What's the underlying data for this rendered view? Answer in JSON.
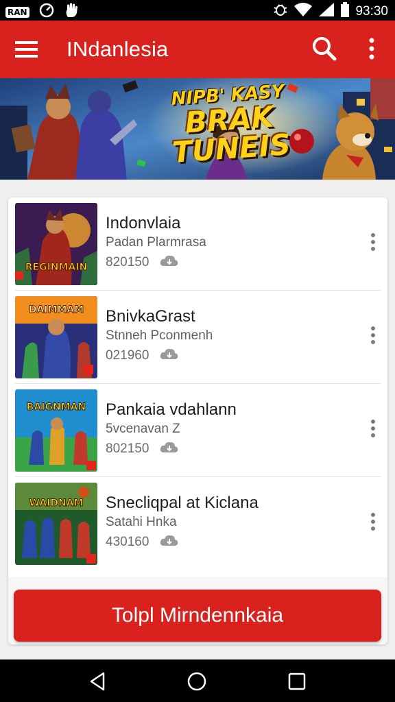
{
  "status_bar": {
    "badge": "RAN",
    "time": "93:30",
    "icons": [
      "speedometer-icon",
      "hand-icon",
      "bug-icon",
      "wifi-icon",
      "signal-icon",
      "battery-icon"
    ]
  },
  "app_bar": {
    "title": "INdanlesia",
    "icons": [
      "menu-icon",
      "search-icon",
      "more-vert-icon"
    ],
    "color": "#d9211d"
  },
  "banner": {
    "line1": "NIPB' KASY",
    "line2": "BRAK TUNEIS"
  },
  "list": [
    {
      "title": "Indonvlaia",
      "subtitle": "Padan Plarmrasa",
      "count": "820150",
      "thumb_text": "REGINMAIN"
    },
    {
      "title": "BnivkaGrast",
      "subtitle": "Stnneh Pconmenh",
      "count": "021960",
      "thumb_text": "DAIMMAM"
    },
    {
      "title": "Pankaia vdahlann",
      "subtitle": "5vcenavan Z",
      "count": "802150",
      "thumb_text": "BAIGNMAN"
    },
    {
      "title": "Snecliqpal at Kiclana",
      "subtitle": "Satahi Hnka",
      "count": "430160",
      "thumb_text": "WAIDNAM"
    }
  ],
  "action_button": {
    "label": "Tolpl Mirndennkaia"
  },
  "nav_bar": {
    "icons": [
      "back-icon",
      "home-icon",
      "recents-icon"
    ]
  },
  "colors": {
    "accent": "#d9211d",
    "background": "#efefef"
  }
}
